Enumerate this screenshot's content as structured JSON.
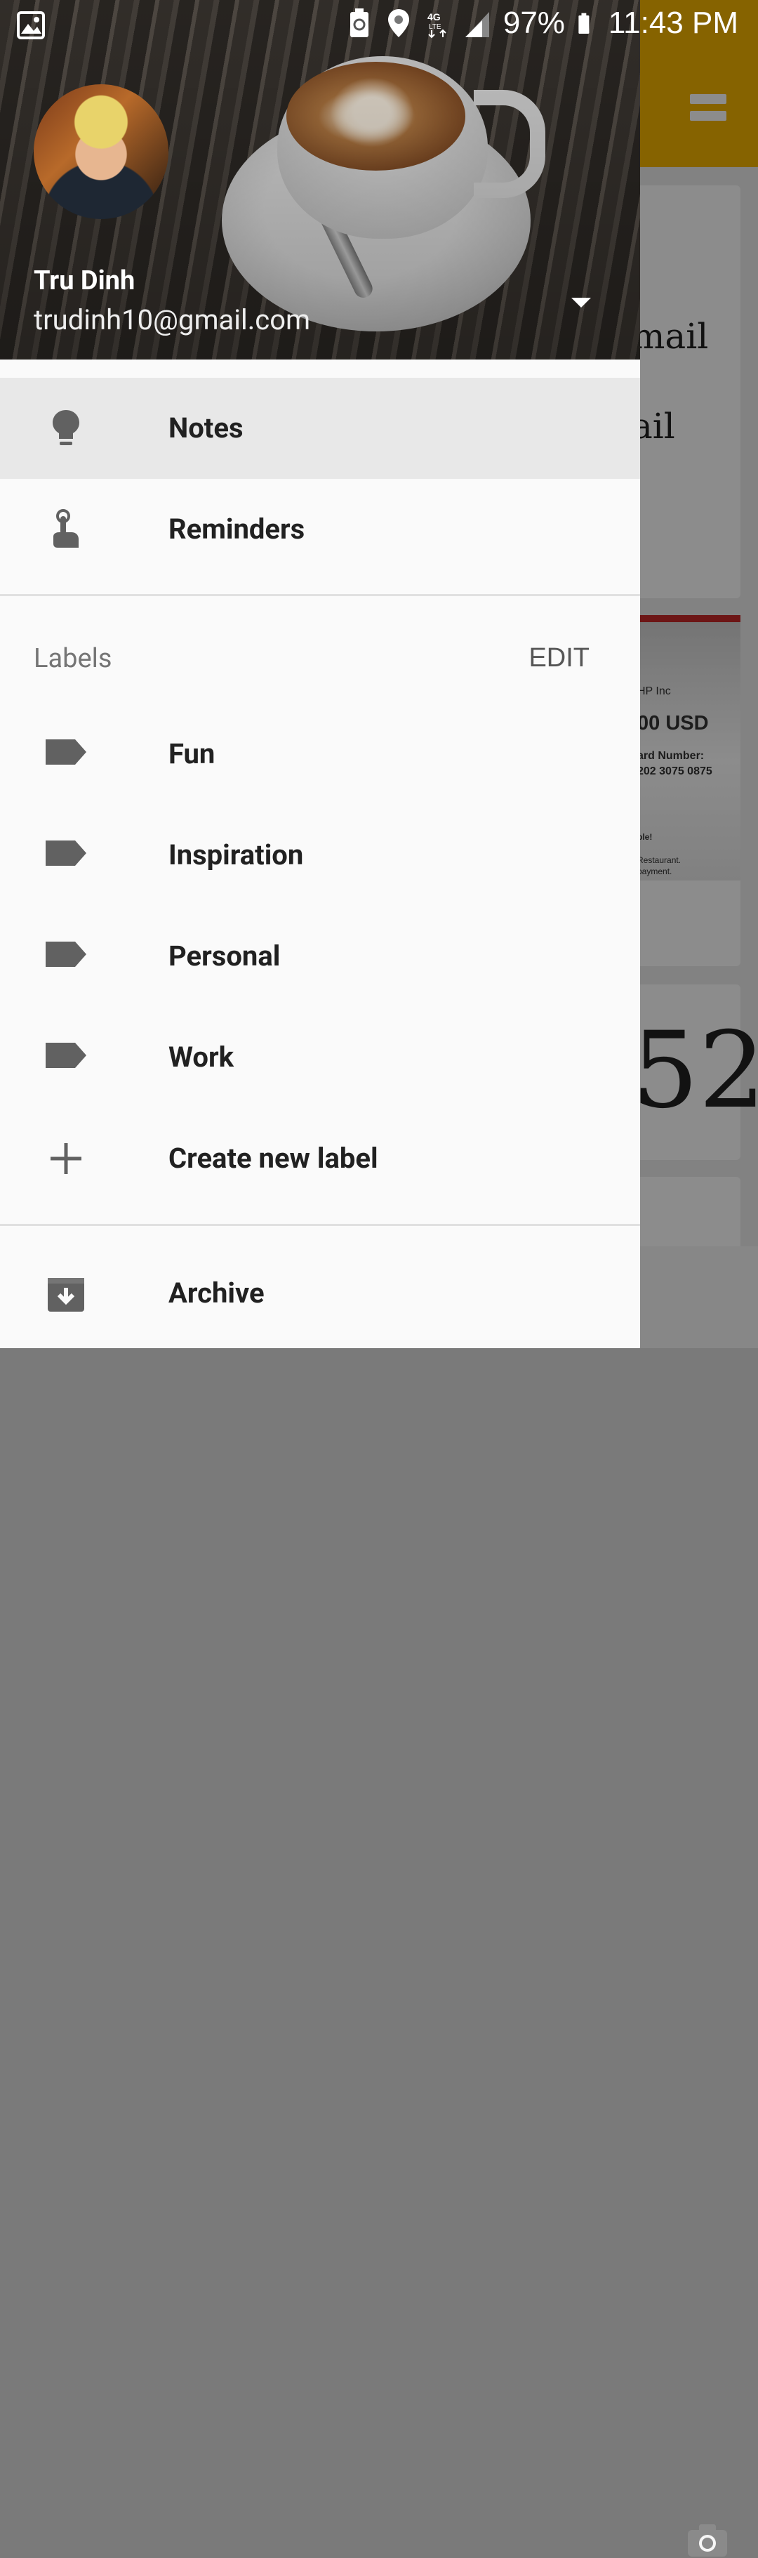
{
  "status_bar": {
    "battery_percent": "97%",
    "time": "11:43 PM",
    "network": "4G LTE"
  },
  "drawer": {
    "account": {
      "name": "Tru Dinh",
      "email": "trudinh10@gmail.com"
    },
    "items": [
      {
        "label": "Notes",
        "icon": "lightbulb-icon",
        "active": true
      },
      {
        "label": "Reminders",
        "icon": "reminder-finger-icon",
        "active": false
      }
    ],
    "labels_section": {
      "title": "Labels",
      "edit_label": "EDIT",
      "labels": [
        {
          "label": "Fun",
          "icon": "label-tag-icon"
        },
        {
          "label": "Inspiration",
          "icon": "label-tag-icon"
        },
        {
          "label": "Personal",
          "icon": "label-tag-icon"
        },
        {
          "label": "Work",
          "icon": "label-tag-icon"
        }
      ],
      "create_label": "Create new label"
    },
    "archive_label": "Archive"
  },
  "background": {
    "card1_line1": "mail",
    "card1_line2": "ail",
    "receipt_company": "HP Inc",
    "receipt_amount": "00 USD",
    "receipt_card_label": "ard Number:",
    "receipt_card_number": "202 3075 0875",
    "receipt_note1": "ble!",
    "receipt_note2": "Restaurant.",
    "receipt_note3": "payment.",
    "card3_big_text": "52"
  },
  "colors": {
    "toolbar": "#f4b400",
    "drawer_bg": "#fafafa",
    "active_item_bg": "#e8e8e8",
    "text_primary": "#212121",
    "text_secondary": "#757575"
  }
}
